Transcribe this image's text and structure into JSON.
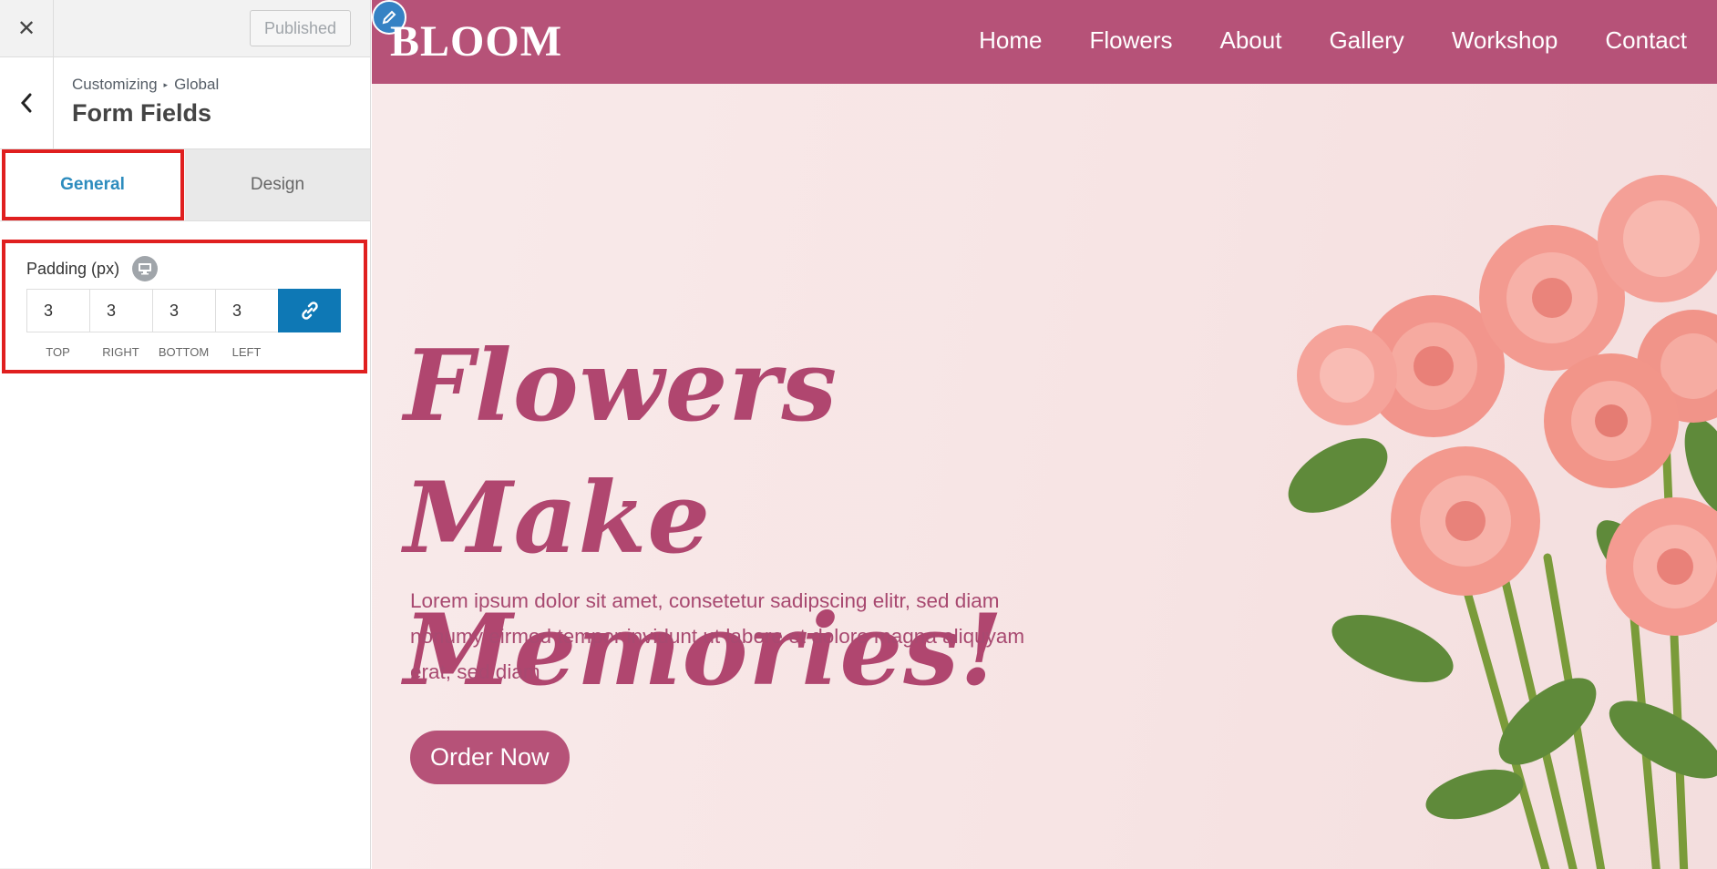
{
  "panel": {
    "close_label": "✕",
    "publish_label": "Published",
    "breadcrumb": {
      "root": "Customizing",
      "separator": "▸",
      "parent": "Global"
    },
    "title": "Form Fields",
    "tabs": [
      {
        "label": "General",
        "active": true
      },
      {
        "label": "Design",
        "active": false
      }
    ],
    "padding": {
      "label": "Padding (px)",
      "values": {
        "top": "3",
        "right": "3",
        "bottom": "3",
        "left": "3"
      },
      "sublabels": [
        "TOP",
        "RIGHT",
        "BOTTOM",
        "LEFT"
      ]
    }
  },
  "site": {
    "logo": "BLOOM",
    "nav": [
      "Home",
      "Flowers",
      "About",
      "Gallery",
      "Workshop",
      "Contact"
    ],
    "headline_line1": "Flowers Make",
    "headline_line2": "Memories!",
    "paragraph": "Lorem ipsum dolor sit amet, consetetur sadipscing elitr, sed diam nonumy eirmod tempor invidunt ut labore et dolore magna aliquyam erat, sed diam",
    "cta": "Order Now"
  },
  "colors": {
    "brand": "#b65278",
    "accent_blue": "#0e78b5",
    "tab_active_text": "#2d8cbe",
    "highlight": "#e01f1f",
    "hero_bg": "#f7e9e9"
  },
  "icons": [
    "close-icon",
    "chevron-left-icon",
    "desktop-device-icon",
    "link-icon",
    "pencil-icon"
  ]
}
